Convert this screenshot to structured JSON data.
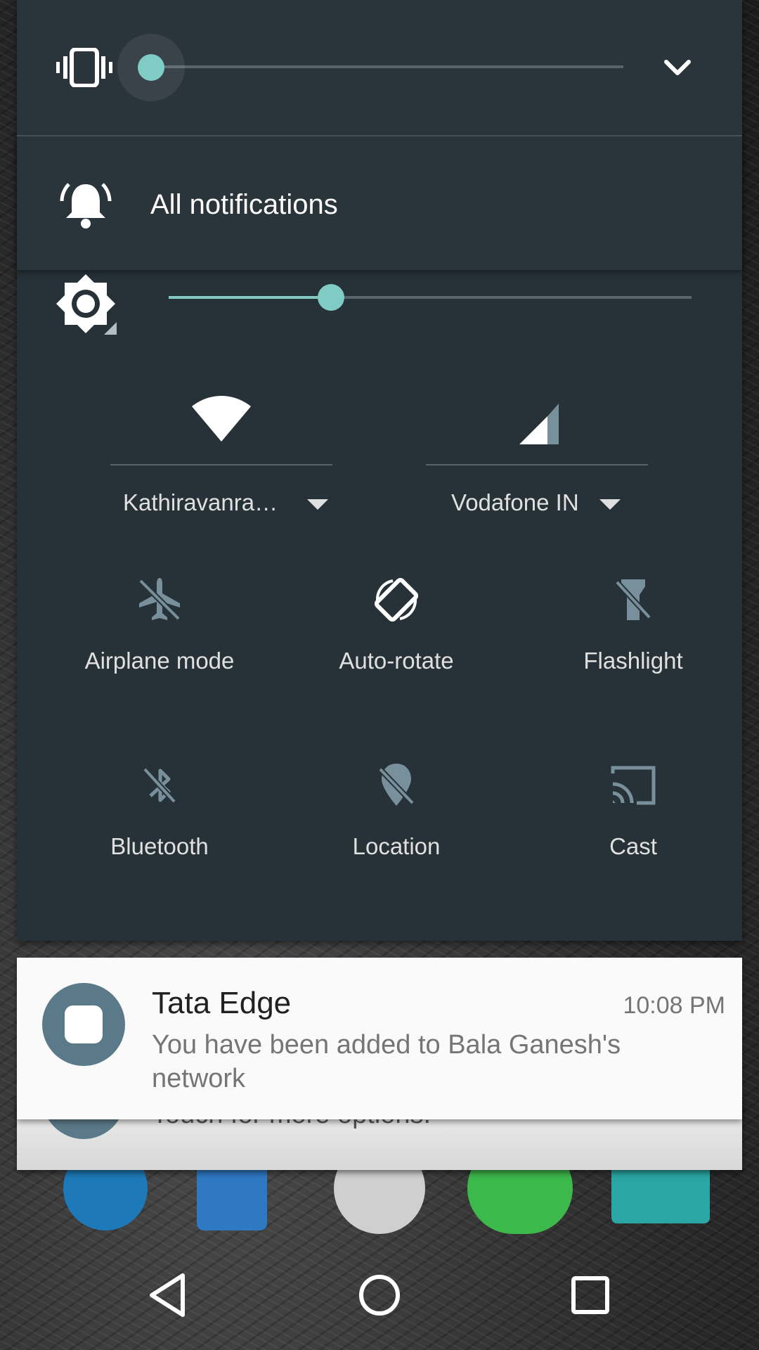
{
  "volume": {
    "mode_icon": "vibrate-icon",
    "expand_icon": "chevron-down-icon",
    "level": 0.0
  },
  "notification_mode": {
    "icon": "bell-icon",
    "label": "All notifications"
  },
  "brightness": {
    "icon": "brightness-icon",
    "level": 0.31,
    "auto": true
  },
  "connections": {
    "wifi": {
      "icon": "wifi-icon",
      "label": "Kathiravanram…"
    },
    "cellular": {
      "icon": "signal-icon",
      "label": "Vodafone IN"
    }
  },
  "quick_settings": [
    {
      "icon": "airplane-icon",
      "label": "Airplane mode",
      "active": false
    },
    {
      "icon": "auto-rotate-icon",
      "label": "Auto-rotate",
      "active": true
    },
    {
      "icon": "flashlight-icon",
      "label": "Flashlight",
      "active": false
    },
    {
      "icon": "bluetooth-icon",
      "label": "Bluetooth",
      "active": false
    },
    {
      "icon": "location-icon",
      "label": "Location",
      "active": false
    },
    {
      "icon": "cast-icon",
      "label": "Cast",
      "active": false
    }
  ],
  "notifications": [
    {
      "app": "Tata Edge",
      "time": "10:08 PM",
      "text": "You have been added to Bala Ganesh's network"
    },
    {
      "text": "Touch for more options."
    }
  ],
  "nav": {
    "back_icon": "back-icon",
    "home_icon": "home-icon",
    "recents_icon": "recents-icon"
  },
  "colors": {
    "shade_bg": "#263238",
    "accent": "#80cbc4",
    "active_icon": "#ffffff",
    "inactive_icon": "#78909c"
  }
}
